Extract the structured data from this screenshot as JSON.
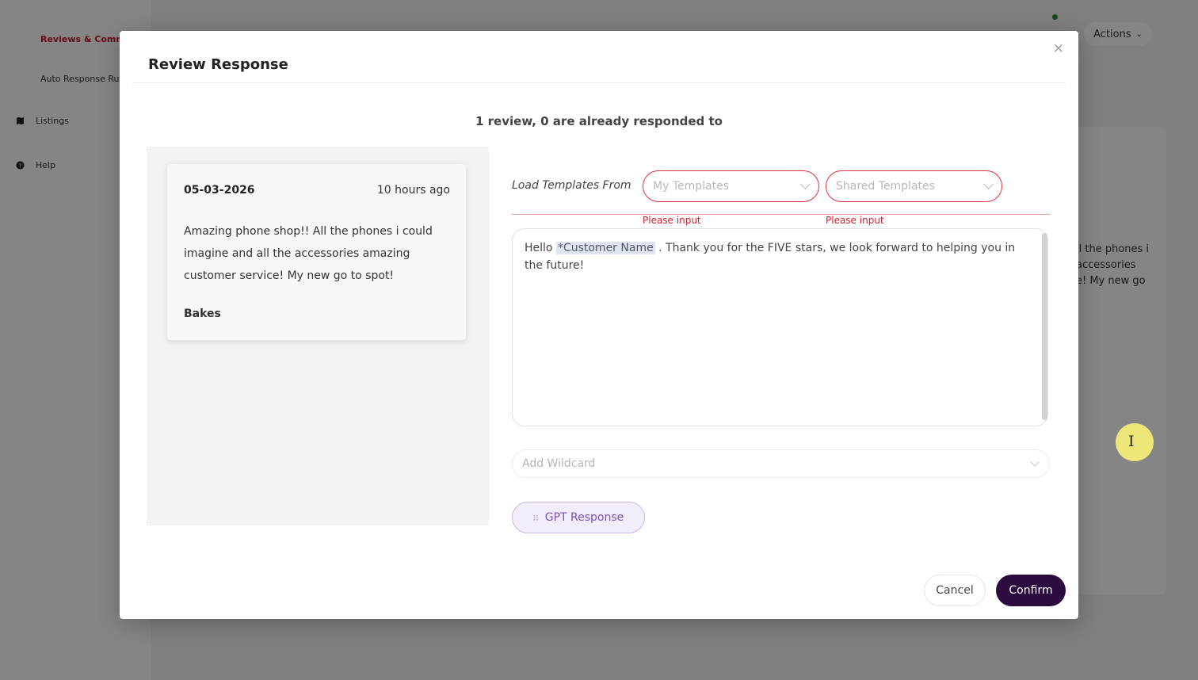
{
  "background": {
    "sidebar": {
      "items": [
        {
          "label": "Reviews & Comme",
          "icon": "none"
        },
        {
          "label": "Auto Response Ru",
          "icon": "none"
        },
        {
          "label": "Listings",
          "icon": "map-icon"
        },
        {
          "label": "Help",
          "icon": "help-circle-icon"
        }
      ]
    },
    "actions_label": "Actions",
    "review_snippet": [
      "ll the phones i",
      "accessories",
      "e! My new go"
    ]
  },
  "modal": {
    "title": "Review Response",
    "close_icon": "×",
    "summary": "1 review, 0 are already responded to",
    "review": {
      "date": "05-03-2026",
      "time_ago": "10 hours ago",
      "text": "Amazing phone shop!! All the phones i could imagine and all the accessories amazing customer service! My new go to spot!",
      "author": "Bakes"
    },
    "templates": {
      "label": "Load Templates From",
      "my_templates": {
        "placeholder": "My Templates",
        "error": "Please input"
      },
      "shared_templates": {
        "placeholder": "Shared Templates",
        "error": "Please input"
      }
    },
    "editor": {
      "prefix": "Hello ",
      "wildcard_tag": "*Customer Name",
      "suffix": " . Thank you for the FIVE stars, we look forward to helping you in the future!"
    },
    "wildcard": {
      "placeholder": "Add Wildcard"
    },
    "gpt_button": {
      "icon": "sparkle-icon",
      "label": "GPT Response"
    },
    "footer": {
      "cancel": "Cancel",
      "confirm": "Confirm"
    },
    "colors": {
      "error": "#d0202c",
      "confirm_bg": "#2c0b3e",
      "gpt_text": "#7a52b8"
    }
  }
}
